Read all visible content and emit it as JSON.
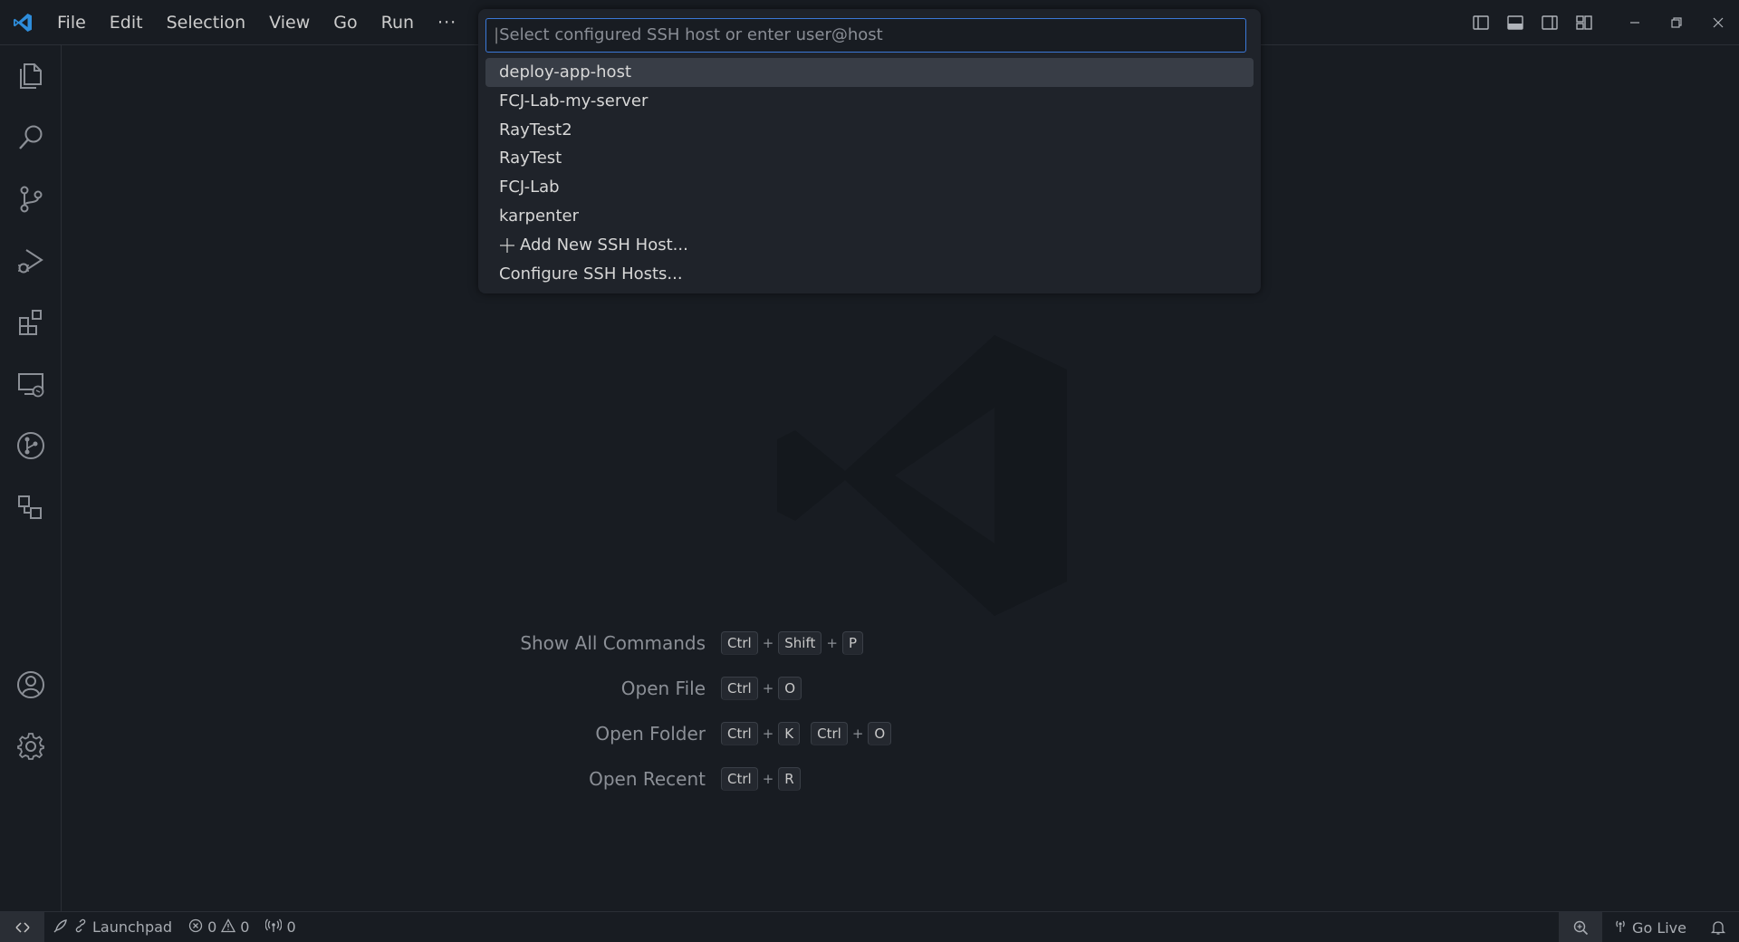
{
  "titlebar": {
    "menu": [
      "File",
      "Edit",
      "Selection",
      "View",
      "Go",
      "Run"
    ],
    "more_label": "···"
  },
  "quickpick": {
    "placeholder": "Select configured SSH host or enter user@host",
    "items": [
      "deploy-app-host",
      "FCJ-Lab-my-server",
      "RayTest2",
      "RayTest",
      "FCJ-Lab",
      "karpenter",
      "Add New SSH Host...",
      "Configure SSH Hosts..."
    ]
  },
  "shortcuts": [
    {
      "label": "Show All Commands",
      "keys": [
        [
          "Ctrl",
          "Shift",
          "P"
        ]
      ]
    },
    {
      "label": "Open File",
      "keys": [
        [
          "Ctrl",
          "O"
        ]
      ]
    },
    {
      "label": "Open Folder",
      "keys": [
        [
          "Ctrl",
          "K"
        ],
        [
          "Ctrl",
          "O"
        ]
      ]
    },
    {
      "label": "Open Recent",
      "keys": [
        [
          "Ctrl",
          "R"
        ]
      ]
    }
  ],
  "statusbar": {
    "launchpad": "Launchpad",
    "errors": "0",
    "warnings": "0",
    "ports": "0",
    "go_live": "Go Live"
  },
  "colors": {
    "background": "#181c22",
    "accent": "#3b78d8",
    "vscode_blue": "#2e8ddb"
  },
  "icons": {
    "activity": [
      "files-icon",
      "search-icon",
      "source-control-icon",
      "run-debug-icon",
      "extensions-icon",
      "remote-explorer-icon",
      "git-graph-icon",
      "aws-toolkit-icon",
      "account-icon",
      "settings-gear-icon"
    ]
  }
}
